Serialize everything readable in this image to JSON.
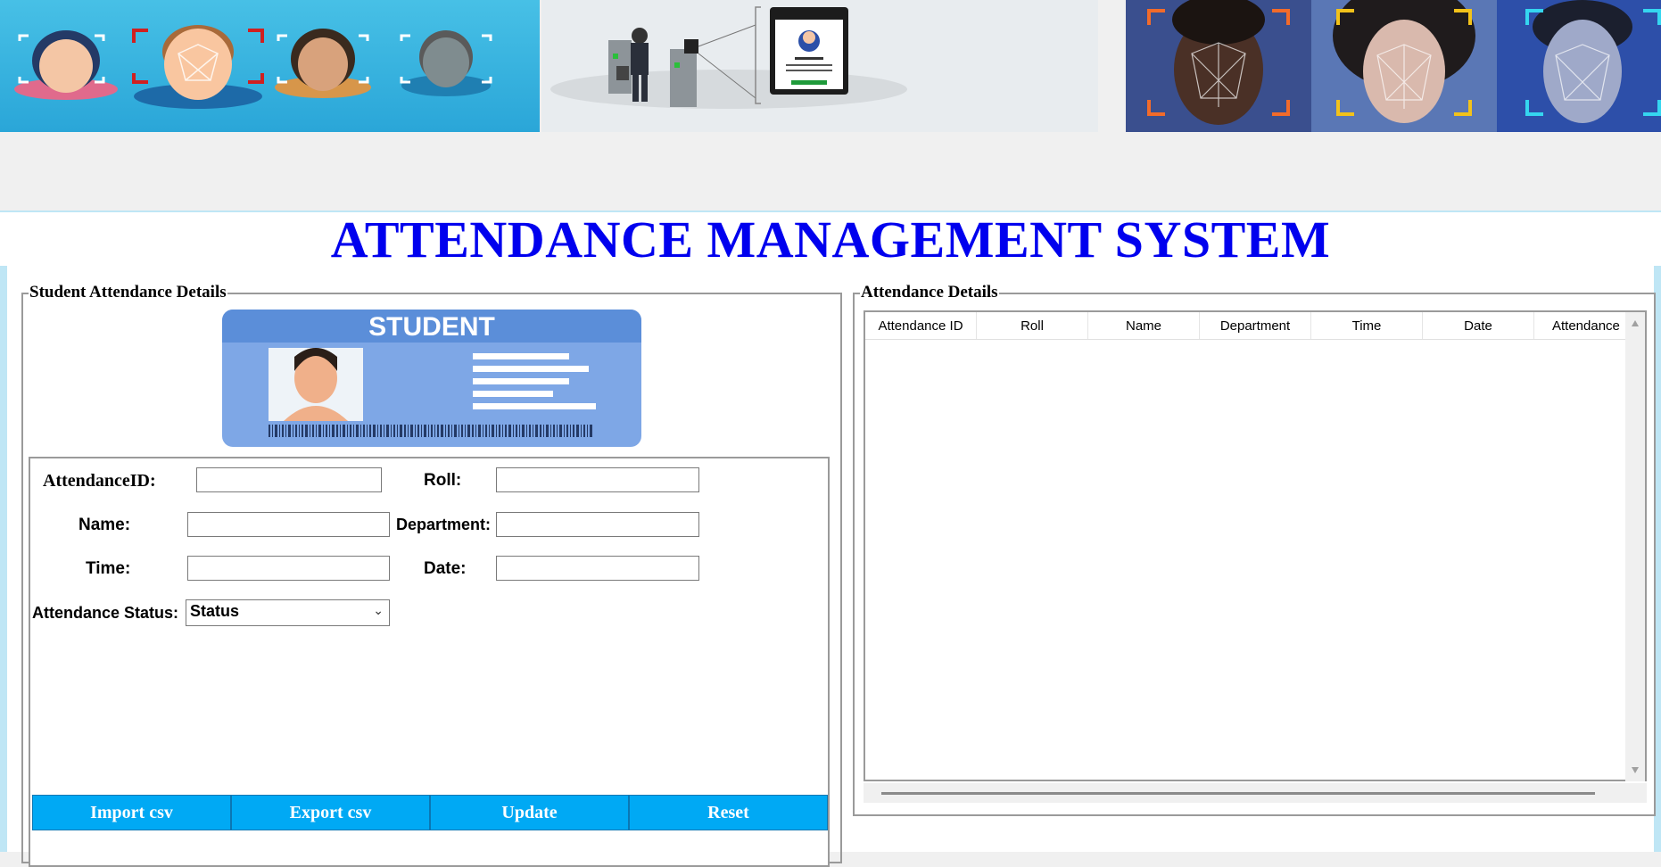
{
  "title": "ATTENDANCE MANAGEMENT SYSTEM",
  "left_panel": {
    "legend": "Student Attendance Details",
    "card_text": "STUDENT",
    "fields": {
      "attendance_id": {
        "label": "AttendanceID:",
        "value": ""
      },
      "roll": {
        "label": "Roll:",
        "value": ""
      },
      "name": {
        "label": "Name:",
        "value": ""
      },
      "department": {
        "label": "Department:",
        "value": ""
      },
      "time": {
        "label": "Time:",
        "value": ""
      },
      "date": {
        "label": "Date:",
        "value": ""
      },
      "status": {
        "label": "Attendance Status:",
        "selected": "Status"
      }
    },
    "buttons": [
      "Import csv",
      "Export csv",
      "Update",
      "Reset"
    ]
  },
  "right_panel": {
    "legend": "Attendance Details",
    "columns": [
      "Attendance ID",
      "Roll",
      "Name",
      "Department",
      "Time",
      "Date",
      "Attendance"
    ],
    "rows": []
  },
  "colors": {
    "title": "#0000ee",
    "button_bg": "#00a9f4",
    "frame_border": "#bfe6f5"
  },
  "icons": {
    "dropdown": "chevron-down-icon",
    "scroll_up": "triangle-up-icon",
    "scroll_down": "triangle-down-icon"
  }
}
